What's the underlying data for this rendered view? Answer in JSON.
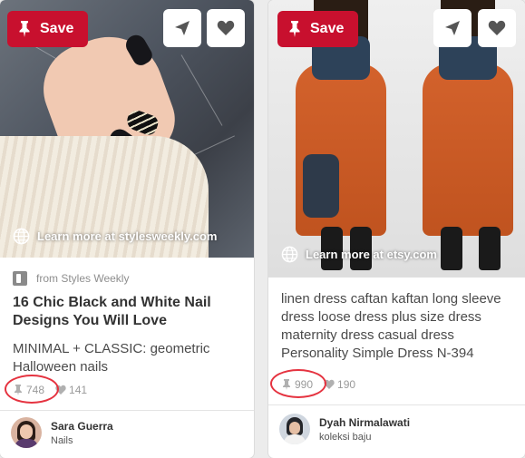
{
  "colors": {
    "save_red": "#c8102e",
    "highlight_red": "#e53340"
  },
  "pins": [
    {
      "save_label": "Save",
      "learn_more": "Learn more at stylesweekly.com",
      "source": "from Styles Weekly",
      "title": "16 Chic Black and White Nail Designs You Will Love",
      "description": "MINIMAL + CLASSIC: geometric Halloween nails",
      "repins": "748",
      "likes": "141",
      "pinner_name": "Sara Guerra",
      "board": "Nails"
    },
    {
      "save_label": "Save",
      "learn_more": "Learn more at etsy.com",
      "description": "linen dress caftan kaftan long sleeve dress loose dress plus size dress maternity dress casual dress Personality Simple Dress N-394",
      "repins": "990",
      "likes": "190",
      "pinner_name": "Dyah Nirmalawati",
      "board": "koleksi baju"
    }
  ],
  "icons": [
    "pin-icon",
    "send-icon",
    "heart-icon",
    "globe-icon",
    "repin-icon",
    "like-icon"
  ]
}
